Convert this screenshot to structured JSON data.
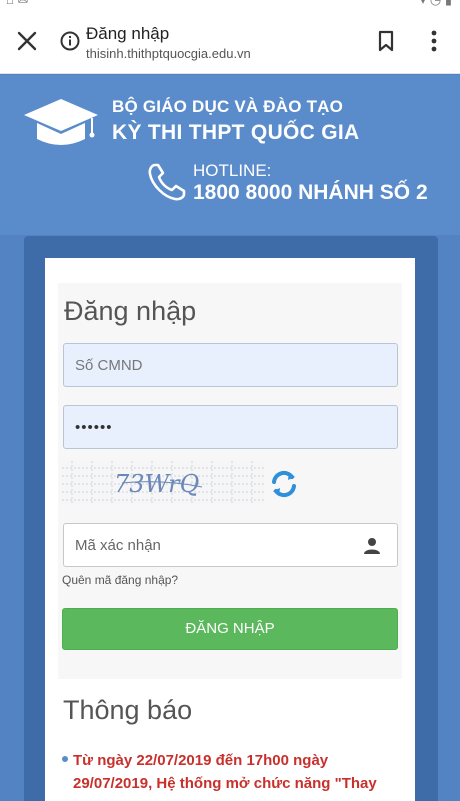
{
  "browser": {
    "title": "Đăng nhập",
    "url": "thisinh.thithptquocgia.edu.vn"
  },
  "header": {
    "org": "BỘ GIÁO DỤC VÀ ĐÀO TẠO",
    "exam": "KỲ THI THPT QUỐC GIA",
    "hotline_label": "HOTLINE:",
    "hotline_number": "1800 8000 NHÁNH SỐ 2"
  },
  "login": {
    "title": "Đăng nhập",
    "id_placeholder": "Số CMND",
    "password_value": "••••••",
    "captcha_text": "73WrQ",
    "code_placeholder": "Mã xác nhận",
    "forgot_link": "Quên mã đăng nhập?",
    "submit_label": "ĐĂNG NHẬP"
  },
  "notice": {
    "title": "Thông báo",
    "items": [
      "Từ ngày 22/07/2019 đến 17h00 ngày 29/07/2019, Hệ thống mở chức năng \"Thay"
    ]
  },
  "colors": {
    "header_bg": "#5a8ccc",
    "panel_bg": "#3d6ca9",
    "button_green": "#5cb85c",
    "notice_red": "#c9302c"
  }
}
